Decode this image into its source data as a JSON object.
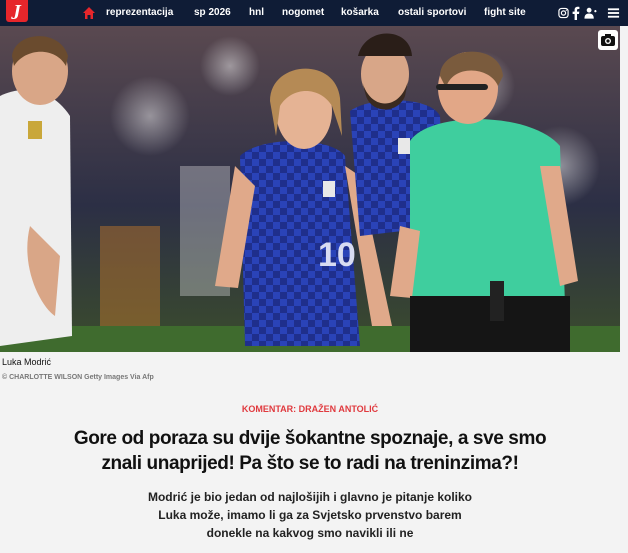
{
  "nav": {
    "logo_letter": "J",
    "items": [
      "reprezentacija",
      "sp 2026",
      "hnl",
      "nogomet",
      "košarka",
      "ostali sportovi",
      "fight site"
    ]
  },
  "photo": {
    "caption": "Luka Modrić",
    "credit": "© CHARLOTTE WILSON Getty Images Via Afp"
  },
  "article": {
    "kicker": "KOMENTAR: DRAŽEN ANTOLIĆ",
    "headline": "Gore od poraza su dvije šokantne spoznaje, a sve smo znali unaprijed! Pa što se to radi na treninzima?!",
    "lead": "Modrić je bio jedan od najlošijih i glavno je pitanje koliko Luka može, imamo li ga za Svjetsko prvenstvo barem donekle na kakvog smo navikli ili ne"
  },
  "colors": {
    "nav_bg": "#0f1c36",
    "accent": "#e6262b",
    "croatia_blue": "#2a43b8",
    "referee_green": "#3fce9e"
  }
}
